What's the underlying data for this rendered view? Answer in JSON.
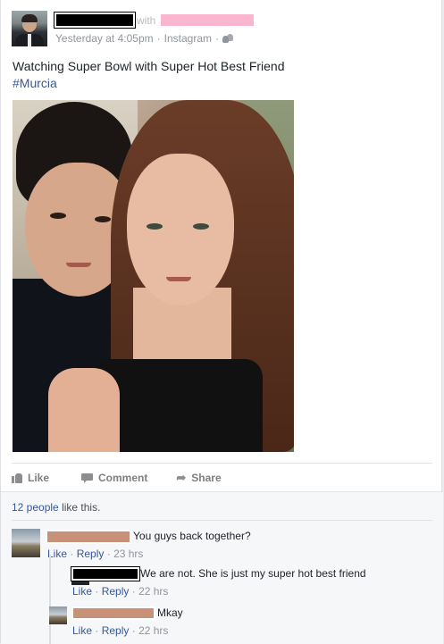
{
  "post": {
    "with_label": "with",
    "timestamp": "Yesterday at 4:05pm",
    "source": "Instagram",
    "separator": "·",
    "audience_icon": "friends-icon",
    "text": "Watching Super Bowl with Super Hot Best Friend",
    "hashtag": "#Murcia"
  },
  "actions": {
    "like": "Like",
    "comment": "Comment",
    "share": "Share"
  },
  "feedback": {
    "likes_count": "12 people",
    "likes_suffix": "like this."
  },
  "comments": [
    {
      "text": "You guys back together?",
      "like": "Like",
      "reply": "Reply",
      "time": "23 hrs",
      "sep": "·"
    },
    {
      "text": "We are not. She is just my super hot best friend",
      "like": "Like",
      "reply": "Reply",
      "time": "22 hrs",
      "sep": "·"
    },
    {
      "text": "Mkay",
      "like": "Like",
      "reply": "Reply",
      "time": "22 hrs",
      "sep": "·"
    }
  ],
  "colors": {
    "link": "#365899",
    "redaction_black": "#000000",
    "redaction_pink": "#fbb6cf",
    "redaction_brown": "#c89278"
  }
}
